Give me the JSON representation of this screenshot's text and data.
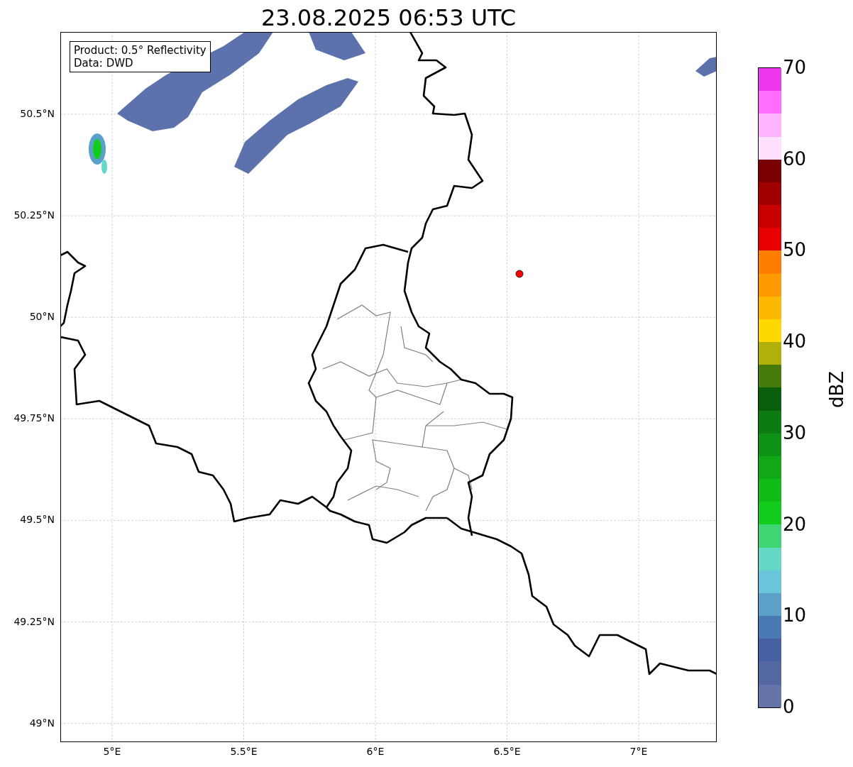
{
  "title": "23.08.2025 06:53 UTC",
  "info_box": {
    "lines": [
      "Product: 0.5° Reflectivity",
      "Data: DWD"
    ]
  },
  "y_ticks": [
    "50.5°N",
    "50.25°N",
    "50°N",
    "49.75°N",
    "49.5°N",
    "49.25°N",
    "49°N"
  ],
  "x_ticks": [
    "5°E",
    "5.5°E",
    "6°E",
    "6.5°E",
    "7°E"
  ],
  "colorbar": {
    "label": "dBZ",
    "ticks": [
      "70",
      "60",
      "50",
      "40",
      "30",
      "20",
      "10",
      "0"
    ],
    "segments": [
      {
        "color": "#6474a8"
      },
      {
        "color": "#5367a0"
      },
      {
        "color": "#4560a3"
      },
      {
        "color": "#4a7ab4"
      },
      {
        "color": "#5ba0c8"
      },
      {
        "color": "#68c5dc"
      },
      {
        "color": "#62d8c5"
      },
      {
        "color": "#3ed672"
      },
      {
        "color": "#12cc1c"
      },
      {
        "color": "#10bb18"
      },
      {
        "color": "#10a816"
      },
      {
        "color": "#0e9216"
      },
      {
        "color": "#0b7b12"
      },
      {
        "color": "#08600c"
      },
      {
        "color": "#467a0a"
      },
      {
        "color": "#b0b00a"
      },
      {
        "color": "#ffd800"
      },
      {
        "color": "#ffb800"
      },
      {
        "color": "#ff9a00"
      },
      {
        "color": "#ff7e00"
      },
      {
        "color": "#e80000"
      },
      {
        "color": "#c80000"
      },
      {
        "color": "#a00000"
      },
      {
        "color": "#780000"
      },
      {
        "color": "#ffe0ff"
      },
      {
        "color": "#ffb4ff"
      },
      {
        "color": "#ff6eff"
      },
      {
        "color": "#ee38ee"
      }
    ]
  }
}
